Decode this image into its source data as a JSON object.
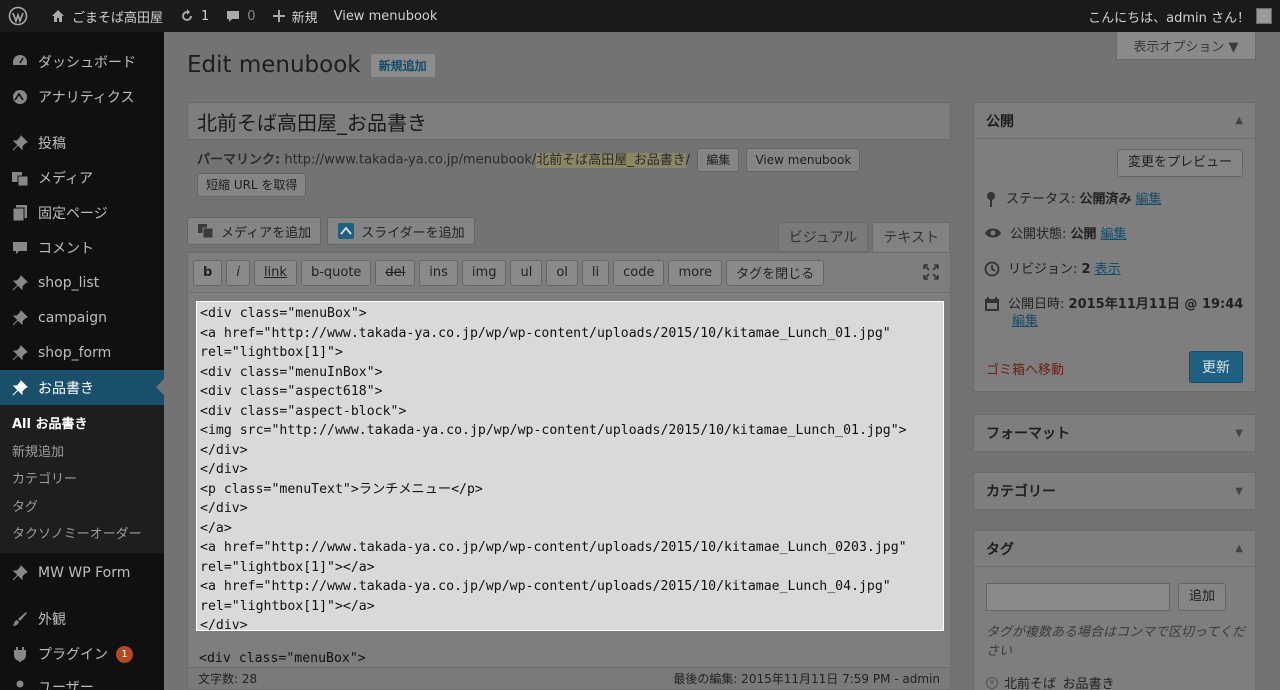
{
  "adminbar": {
    "site_name": "ごまそば高田屋",
    "updates_count": "1",
    "comments_count": "0",
    "new_label": "新規",
    "view_label": "View menubook",
    "greeting": "こんにちは、admin さん！"
  },
  "sidebar": {
    "items": [
      {
        "label": "ダッシュボード",
        "icon": "dashboard-icon"
      },
      {
        "label": "アナリティクス",
        "icon": "analytics-icon"
      },
      {
        "label": "投稿",
        "icon": "pin-icon"
      },
      {
        "label": "メディア",
        "icon": "media-icon"
      },
      {
        "label": "固定ページ",
        "icon": "page-icon"
      },
      {
        "label": "コメント",
        "icon": "comment-icon"
      },
      {
        "label": "shop_list",
        "icon": "pin-icon"
      },
      {
        "label": "campaign",
        "icon": "pin-icon"
      },
      {
        "label": "shop_form",
        "icon": "pin-icon"
      },
      {
        "label": "お品書き",
        "icon": "pin-icon"
      },
      {
        "label": "MW WP Form",
        "icon": "pin-icon"
      },
      {
        "label": "外観",
        "icon": "brush-icon"
      },
      {
        "label": "プラグイン",
        "icon": "plugin-icon",
        "badge": "1"
      },
      {
        "label": "ユーザー",
        "icon": "user-icon"
      }
    ],
    "submenu": [
      "All お品書き",
      "新規追加",
      "カテゴリー",
      "タグ",
      "タクソノミーオーダー"
    ]
  },
  "screen_options": "表示オプション ▼",
  "page": {
    "title": "Edit menubook",
    "add_new": "新規追加",
    "post_title": "北前そば高田屋_お品書き"
  },
  "permalink": {
    "label": "パーマリンク:",
    "base": "http://www.takada-ya.co.jp/menubook/",
    "slug": "北前そば高田屋_お品書き",
    "trail": "/",
    "edit_btn": "編集",
    "view_btn": "View menubook",
    "shortlink_btn": "短縮 URL を取得"
  },
  "media": {
    "add_media": "メディアを追加",
    "add_slider": "スライダーを追加"
  },
  "editor": {
    "tab_visual": "ビジュアル",
    "tab_text": "テキスト",
    "buttons": [
      "b",
      "i",
      "link",
      "b-quote",
      "del",
      "ins",
      "img",
      "ul",
      "ol",
      "li",
      "code",
      "more",
      "タグを閉じる"
    ],
    "code": "<div class=\"menuBox\">\n<a href=\"http://www.takada-ya.co.jp/wp/wp-content/uploads/2015/10/kitamae_Lunch_01.jpg\"\nrel=\"lightbox[1]\">\n<div class=\"menuInBox\">\n<div class=\"aspect618\">\n<div class=\"aspect-block\">\n<img src=\"http://www.takada-ya.co.jp/wp/wp-content/uploads/2015/10/kitamae_Lunch_01.jpg\">\n</div>\n</div>\n<p class=\"menuText\">ランチメニュー</p>\n</div>\n</a>\n<a href=\"http://www.takada-ya.co.jp/wp/wp-content/uploads/2015/10/kitamae_Lunch_0203.jpg\"\nrel=\"lightbox[1]\"></a>\n<a href=\"http://www.takada-ya.co.jp/wp/wp-content/uploads/2015/10/kitamae_Lunch_04.jpg\"\nrel=\"lightbox[1]\"></a>\n</div>",
    "code_after": "<div class=\"menuBox\">",
    "word_count": "文字数: 28",
    "last_edit": "最後の編集: 2015年11月11日 7:59 PM - admin"
  },
  "publish": {
    "title": "公開",
    "preview_btn": "変更をプレビュー",
    "status_label": "ステータス:",
    "status_value": "公開済み",
    "visibility_label": "公開状態:",
    "visibility_value": "公開",
    "revisions_label": "リビジョン:",
    "revisions_value": "2",
    "revisions_link": "表示",
    "date_label": "公開日時:",
    "date_value": "2015年11月11日 @ 19:44",
    "edit_link": "編集",
    "trash": "ゴミ箱へ移動",
    "update_btn": "更新"
  },
  "format": {
    "title": "フォーマット"
  },
  "category": {
    "title": "カテゴリー"
  },
  "tags": {
    "title": "タグ",
    "add_btn": "追加",
    "hint": "タグが複数ある場合はコンマで区切ってください",
    "items": [
      "北前そば_お品書き"
    ]
  }
}
